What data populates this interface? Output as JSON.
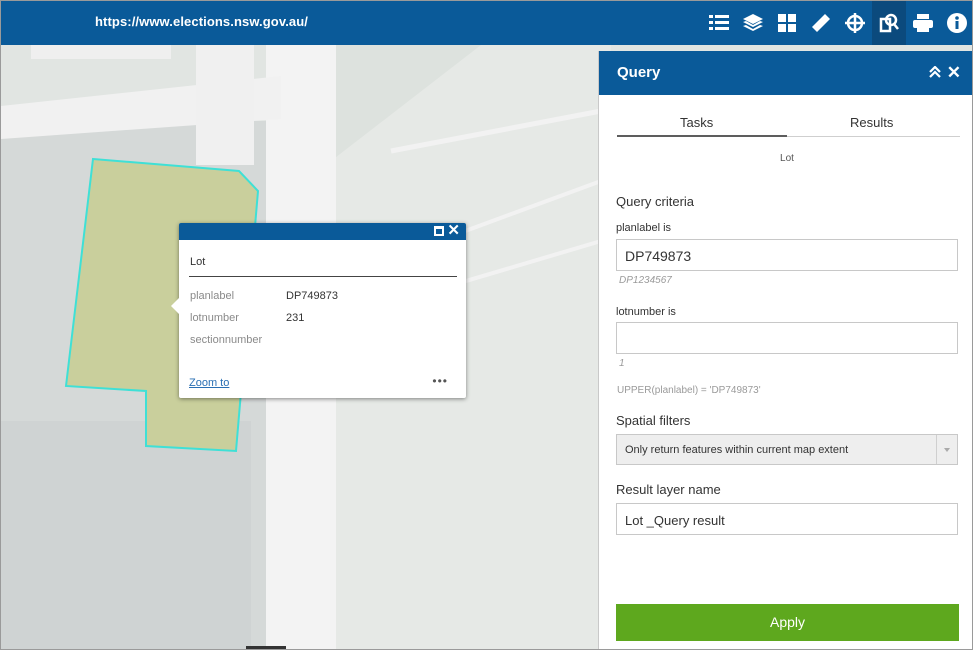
{
  "header": {
    "url": "https://www.elections.nsw.gov.au/",
    "tools": [
      {
        "icon": "layer-list-icon",
        "active": false
      },
      {
        "icon": "layers-icon",
        "active": false
      },
      {
        "icon": "basemap-gallery-icon",
        "active": false
      },
      {
        "icon": "measurement-icon",
        "active": false
      },
      {
        "icon": "analysis-icon",
        "active": false
      },
      {
        "icon": "query-icon",
        "active": true
      },
      {
        "icon": "print-icon",
        "active": false
      },
      {
        "icon": "about-icon",
        "active": false
      }
    ]
  },
  "popup": {
    "title": "Lot",
    "fields": [
      {
        "name": "planlabel",
        "value": "DP749873"
      },
      {
        "name": "lotnumber",
        "value": "231"
      },
      {
        "name": "sectionnumber",
        "value": ""
      }
    ],
    "zoom_label": "Zoom to",
    "more_label": "•••"
  },
  "query": {
    "title": "Query",
    "tabs": {
      "tasks": "Tasks",
      "results": "Results",
      "active": "Tasks"
    },
    "layer": "Lot",
    "criteria_label": "Query criteria",
    "field1": {
      "label": "planlabel is",
      "value": "DP749873",
      "hint": "DP1234567"
    },
    "field2": {
      "label": "lotnumber is",
      "value": "",
      "hint": "1"
    },
    "expression": "UPPER(planlabel) = 'DP749873'",
    "spatial_label": "Spatial filters",
    "spatial_value": "Only return features within current map extent",
    "result_label": "Result layer name",
    "result_value": "Lot _Query result",
    "apply_label": "Apply"
  },
  "colors": {
    "header": "#0a5a99",
    "apply": "#5ea81e",
    "parcel_fill": "#c9cf9c",
    "parcel_outline": "#3fe0d6"
  }
}
